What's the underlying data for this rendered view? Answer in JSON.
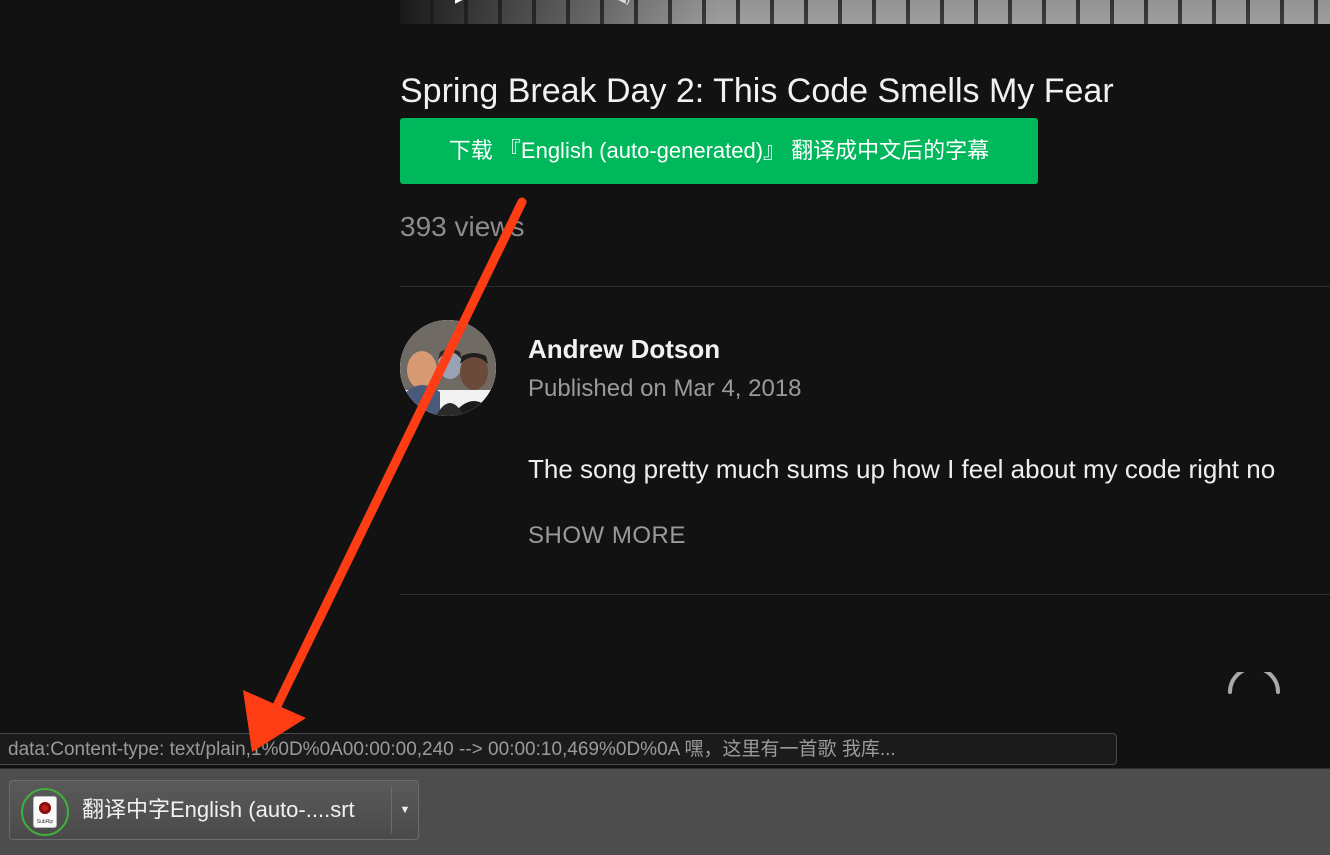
{
  "video": {
    "title": "Spring Break Day 2: This Code Smells My Fear",
    "views": "393 views",
    "controls": {
      "play_glyph": "▶",
      "volume_glyph": "◀)"
    }
  },
  "extension": {
    "download_button_label": "下载 『English (auto-generated)』 翻译成中文后的字幕",
    "accent_color": "#00b85c"
  },
  "channel": {
    "name": "Andrew Dotson",
    "published": "Published on Mar 4, 2018",
    "description": "The song pretty much sums up how I feel about my code right no",
    "show_more_label": "SHOW MORE"
  },
  "status_bar": {
    "url": "data:Content-type: text/plain,1%0D%0A00:00:00,240 --> 00:00:10,469%0D%0A 嘿，这里有一首歌 我库..."
  },
  "download_shelf": {
    "item": {
      "filename": "翻译中字English (auto-....srt",
      "file_icon_label": "SubRip",
      "menu_glyph": "▼"
    }
  },
  "annotation": {
    "arrow_color": "#ff3d14"
  }
}
